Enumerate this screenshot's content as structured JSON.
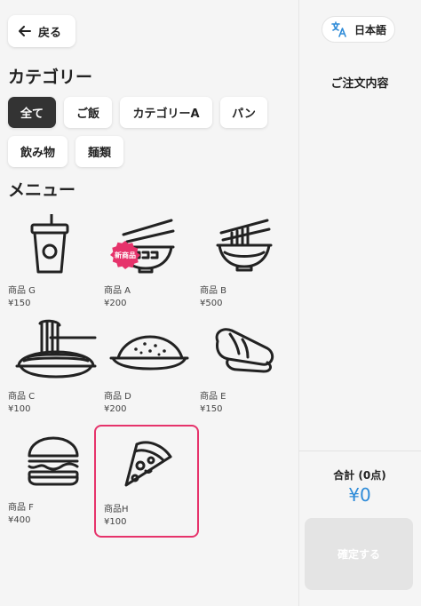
{
  "header": {
    "back_label": "戻る"
  },
  "category_section": {
    "title": "カテゴリー",
    "chips": [
      {
        "label": "全て",
        "active": true
      },
      {
        "label": "ご飯",
        "active": false
      },
      {
        "label": "カテゴリーA",
        "active": false
      },
      {
        "label": "パン",
        "active": false
      },
      {
        "label": "飲み物",
        "active": false
      },
      {
        "label": "麺類",
        "active": false
      }
    ]
  },
  "menu_section": {
    "title": "メニュー",
    "items": [
      {
        "name": "商品 G",
        "price": "¥150",
        "icon": "drink-cup-icon"
      },
      {
        "name": "商品 A",
        "price": "¥200",
        "icon": "ramen-bowl-icon",
        "badge": "新商品"
      },
      {
        "name": "商品 B",
        "price": "¥500",
        "icon": "noodle-bowl-icon"
      },
      {
        "name": "商品 C",
        "price": "¥100",
        "icon": "spaghetti-icon"
      },
      {
        "name": "商品 D",
        "price": "¥200",
        "icon": "fried-rice-icon"
      },
      {
        "name": "商品 E",
        "price": "¥150",
        "icon": "sushi-icon"
      },
      {
        "name": "商品 F",
        "price": "¥400",
        "icon": "hamburger-icon"
      },
      {
        "name": "商品H",
        "price": "¥100",
        "icon": "pizza-slice-icon",
        "selected": true
      }
    ]
  },
  "sidebar": {
    "language_label": "日本語",
    "order_title": "ご注文内容",
    "total_label": "合計 (0点)",
    "total_value": "¥0",
    "confirm_label": "確定する"
  },
  "colors": {
    "accent_blue": "#2e8bd8",
    "selected_border": "#e6336b",
    "active_chip": "#333333",
    "badge": "#e6336b"
  }
}
